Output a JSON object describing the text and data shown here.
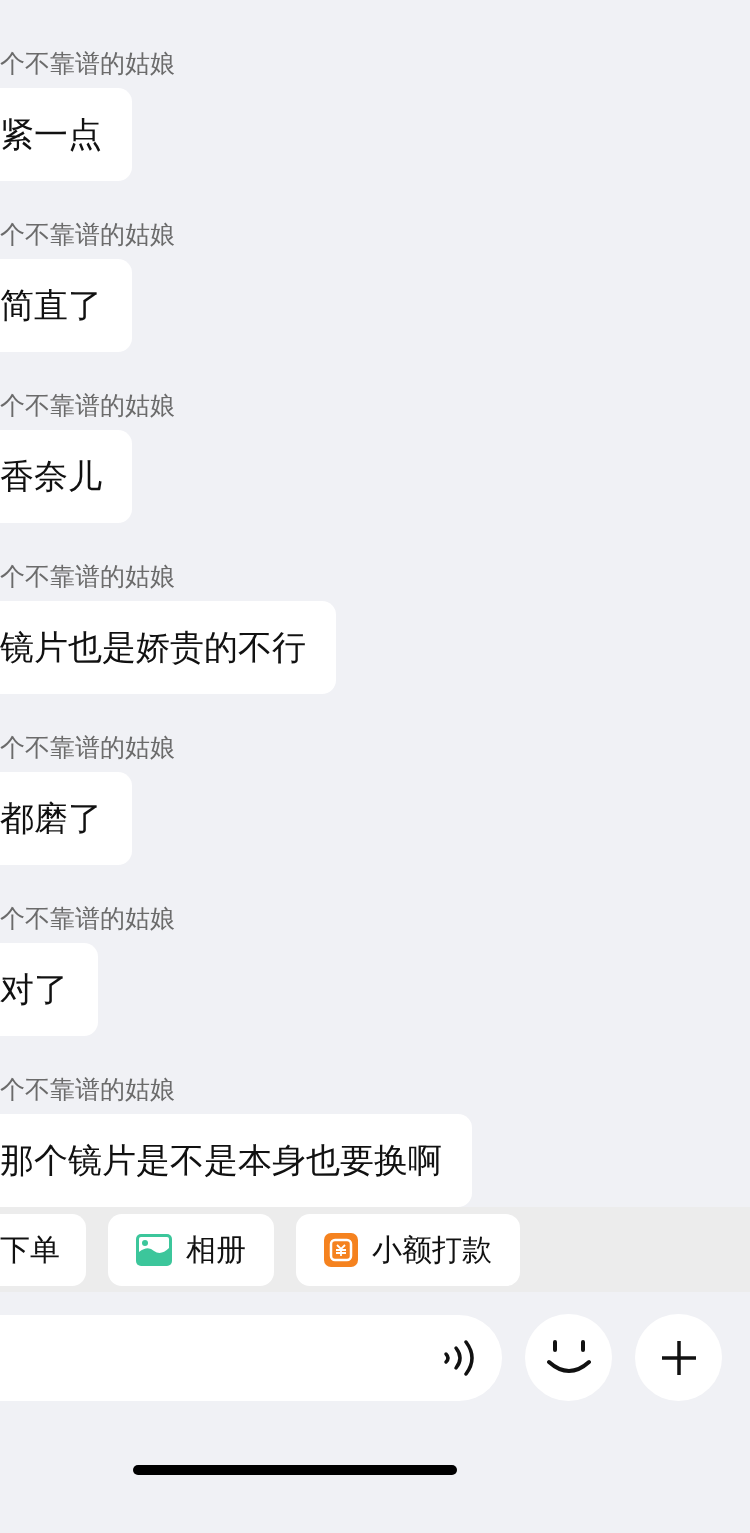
{
  "messages": [
    {
      "sender": "个不靠谱的姑娘",
      "text": "紧一点"
    },
    {
      "sender": "个不靠谱的姑娘",
      "text": "简直了"
    },
    {
      "sender": "个不靠谱的姑娘",
      "text": "香奈儿"
    },
    {
      "sender": "个不靠谱的姑娘",
      "text": "镜片也是娇贵的不行"
    },
    {
      "sender": "个不靠谱的姑娘",
      "text": "都磨了"
    },
    {
      "sender": "个不靠谱的姑娘",
      "text": "对了"
    },
    {
      "sender": "个不靠谱的姑娘",
      "text": "那个镜片是不是本身也要换啊"
    }
  ],
  "quick_actions": [
    {
      "kind": "text",
      "label": "下单"
    },
    {
      "kind": "album",
      "label": "相册"
    },
    {
      "kind": "transfer",
      "label": "小额打款"
    }
  ]
}
